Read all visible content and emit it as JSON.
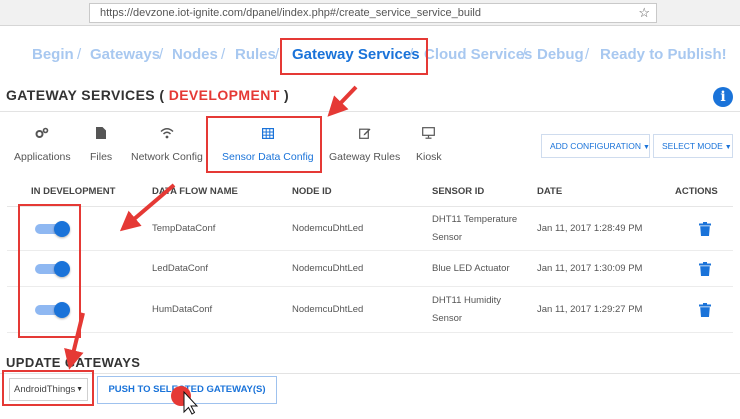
{
  "browser": {
    "url": "https://devzone.iot-ignite.com/dpanel/index.php#/create_service_service_build"
  },
  "wizard": {
    "steps": [
      "Begin",
      "Gateways",
      "Nodes",
      "Rules",
      "Gateway Services",
      "Cloud Services",
      "Debug",
      "Ready to Publish!"
    ],
    "separator": "/",
    "active_step": "Gateway Services"
  },
  "header": {
    "title": "GATEWAY SERVICES (",
    "environment": "DEVELOPMENT",
    "title_end": ")"
  },
  "tabs": [
    {
      "label": "Applications",
      "icon": "gears-icon"
    },
    {
      "label": "Files",
      "icon": "file-icon"
    },
    {
      "label": "Network Config",
      "icon": "wifi-icon"
    },
    {
      "label": "Sensor Data Config",
      "icon": "grid-table-icon",
      "active": true
    },
    {
      "label": "Gateway Rules",
      "icon": "edit-icon"
    },
    {
      "label": "Kiosk",
      "icon": "monitor-icon"
    }
  ],
  "toolbar": {
    "add_configuration": "ADD CONFIGURATION",
    "select_mode": "SELECT MODE"
  },
  "table": {
    "columns": [
      "IN DEVELOPMENT",
      "DATA FLOW NAME",
      "NODE ID",
      "SENSOR ID",
      "DATE",
      "ACTIONS"
    ],
    "rows": [
      {
        "enabled": true,
        "name": "TempDataConf",
        "node": "NodemcuDhtLed",
        "sensor_line1": "DHT11 Temperature",
        "sensor_line2": "Sensor",
        "date": "Jan 11, 2017 1:28:49 PM"
      },
      {
        "enabled": true,
        "name": "LedDataConf",
        "node": "NodemcuDhtLed",
        "sensor_line1": "Blue LED Actuator",
        "sensor_line2": "",
        "date": "Jan 11, 2017 1:30:09 PM"
      },
      {
        "enabled": true,
        "name": "HumDataConf",
        "node": "NodemcuDhtLed",
        "sensor_line1": "DHT11 Humidity",
        "sensor_line2": "Sensor",
        "date": "Jan 11, 2017 1:29:27 PM"
      }
    ]
  },
  "update": {
    "title": "UPDATE GATEWAYS",
    "selected_gateway": "AndroidThings",
    "push_label": "PUSH TO SELECTED GATEWAY(S)"
  },
  "colors": {
    "accent": "#1a73d9",
    "highlight": "#e53935",
    "disabled_step": "#a8c8f0"
  }
}
